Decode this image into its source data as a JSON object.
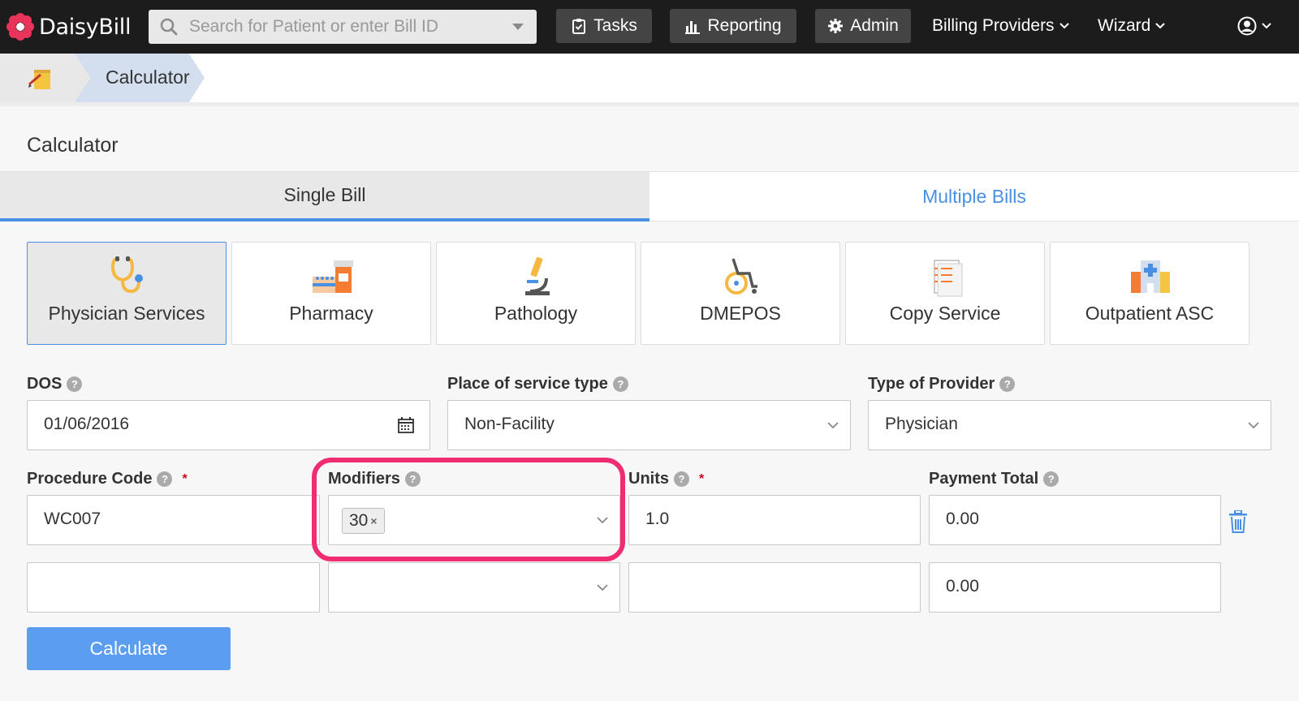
{
  "app": {
    "name": "DaisyBill"
  },
  "nav": {
    "search_placeholder": "Search for Patient or enter Bill ID",
    "tasks": "Tasks",
    "reporting": "Reporting",
    "admin": "Admin",
    "billing_providers": "Billing Providers",
    "wizard": "Wizard"
  },
  "breadcrumb": {
    "current": "Calculator"
  },
  "page": {
    "title": "Calculator"
  },
  "tabs": {
    "single": "Single Bill",
    "multiple": "Multiple Bills"
  },
  "service_types": [
    {
      "label": "Physician Services",
      "icon": "stethoscope-icon",
      "selected": true
    },
    {
      "label": "Pharmacy",
      "icon": "pharmacy-icon"
    },
    {
      "label": "Pathology",
      "icon": "microscope-icon"
    },
    {
      "label": "DMEPOS",
      "icon": "wheelchair-icon"
    },
    {
      "label": "Copy Service",
      "icon": "document-icon"
    },
    {
      "label": "Outpatient ASC",
      "icon": "hospital-icon"
    }
  ],
  "form": {
    "dos_label": "DOS",
    "dos_value": "01/06/2016",
    "pos_label": "Place of service type",
    "pos_value": "Non-Facility",
    "provider_label": "Type of Provider",
    "provider_value": "Physician",
    "procedure_label": "Procedure Code",
    "modifiers_label": "Modifiers",
    "units_label": "Units",
    "payment_label": "Payment Total",
    "required_mark": "*",
    "rows": [
      {
        "procedure": "WC007",
        "modifier_chip": "30",
        "units": "1.0",
        "payment": "0.00"
      },
      {
        "procedure": "",
        "modifier_chip": "",
        "units": "",
        "payment": "0.00"
      }
    ]
  },
  "calculate_label": "Calculate",
  "colors": {
    "accent": "#4a90e2",
    "highlight": "#f02d73",
    "nav_bg": "#1c1c1c"
  }
}
